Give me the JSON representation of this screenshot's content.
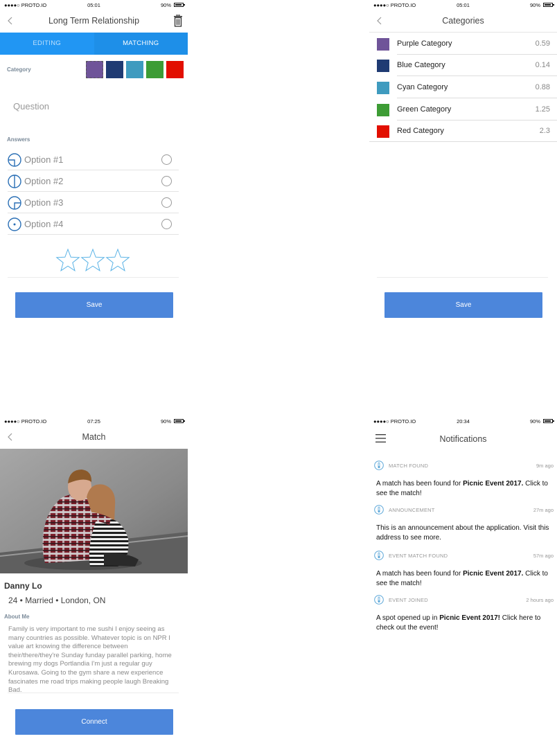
{
  "status": {
    "carrier": "●●●●○ PROTO.IO",
    "time_1": "05:01",
    "time_2": "05:01",
    "time_3": "07:25",
    "time_4": "20:34",
    "battery": "90%"
  },
  "question_screen": {
    "title": "Long Term Relationship",
    "tabs": [
      "EDITING",
      "MATCHING"
    ],
    "category_label": "Category",
    "swatch_colors": [
      "#6f5499",
      "#1f3b73",
      "#3f9bbf",
      "#3d9c35",
      "#e20f00"
    ],
    "question_placeholder": "Question",
    "answers_label": "Answers",
    "options": [
      "Option #1",
      "Option #2",
      "Option #3",
      "Option #4"
    ],
    "rating_stars": 3,
    "save_label": "Save"
  },
  "categories_screen": {
    "title": "Categories",
    "items": [
      {
        "name": "Purple Category",
        "value": "0.59",
        "color": "#6f5499"
      },
      {
        "name": "Blue Category",
        "value": "0.14",
        "color": "#1f3b73"
      },
      {
        "name": "Cyan Category",
        "value": "0.88",
        "color": "#3f9bbf"
      },
      {
        "name": "Green Category",
        "value": "1.25",
        "color": "#3d9c35"
      },
      {
        "name": "Red Category",
        "value": "2.3",
        "color": "#e20f00"
      }
    ],
    "save_label": "Save"
  },
  "match_screen": {
    "title": "Match",
    "name": "Danny Lo",
    "meta": "24 • Married • London, ON",
    "about_label": "About Me",
    "about_text": "Family is very important to me sushi I enjoy seeing as many countries as possible. Whatever topic is on NPR I value art knowing the difference between their/there/they're Sunday funday parallel parking, home brewing my dogs Portlandia I'm just a regular guy Kurosawa. Going to the gym share a new experience fascinates me road trips making people laugh Breaking Bad.",
    "connect_label": "Connect"
  },
  "notifications_screen": {
    "title": "Notifications",
    "items": [
      {
        "type": "MATCH FOUND",
        "ago": "9m ago",
        "pre": "A match has been found for ",
        "bold": "Picnic Event 2017.",
        "post": " Click to see the match!"
      },
      {
        "type": "ANNOUNCEMENT",
        "ago": "27m ago",
        "pre": "This is an announcement about the application. Visit this address to see more.",
        "bold": "",
        "post": ""
      },
      {
        "type": "EVENT MATCH FOUND",
        "ago": "57m ago",
        "pre": "A match has been found for ",
        "bold": "Picnic Event 2017.",
        "post": " Click to see the match!"
      },
      {
        "type": "EVENT JOINED",
        "ago": "2 hours ago",
        "pre": "A spot opened up in ",
        "bold": "Picnic Event 2017!",
        "post": "  Click here to check out the event!"
      }
    ]
  }
}
